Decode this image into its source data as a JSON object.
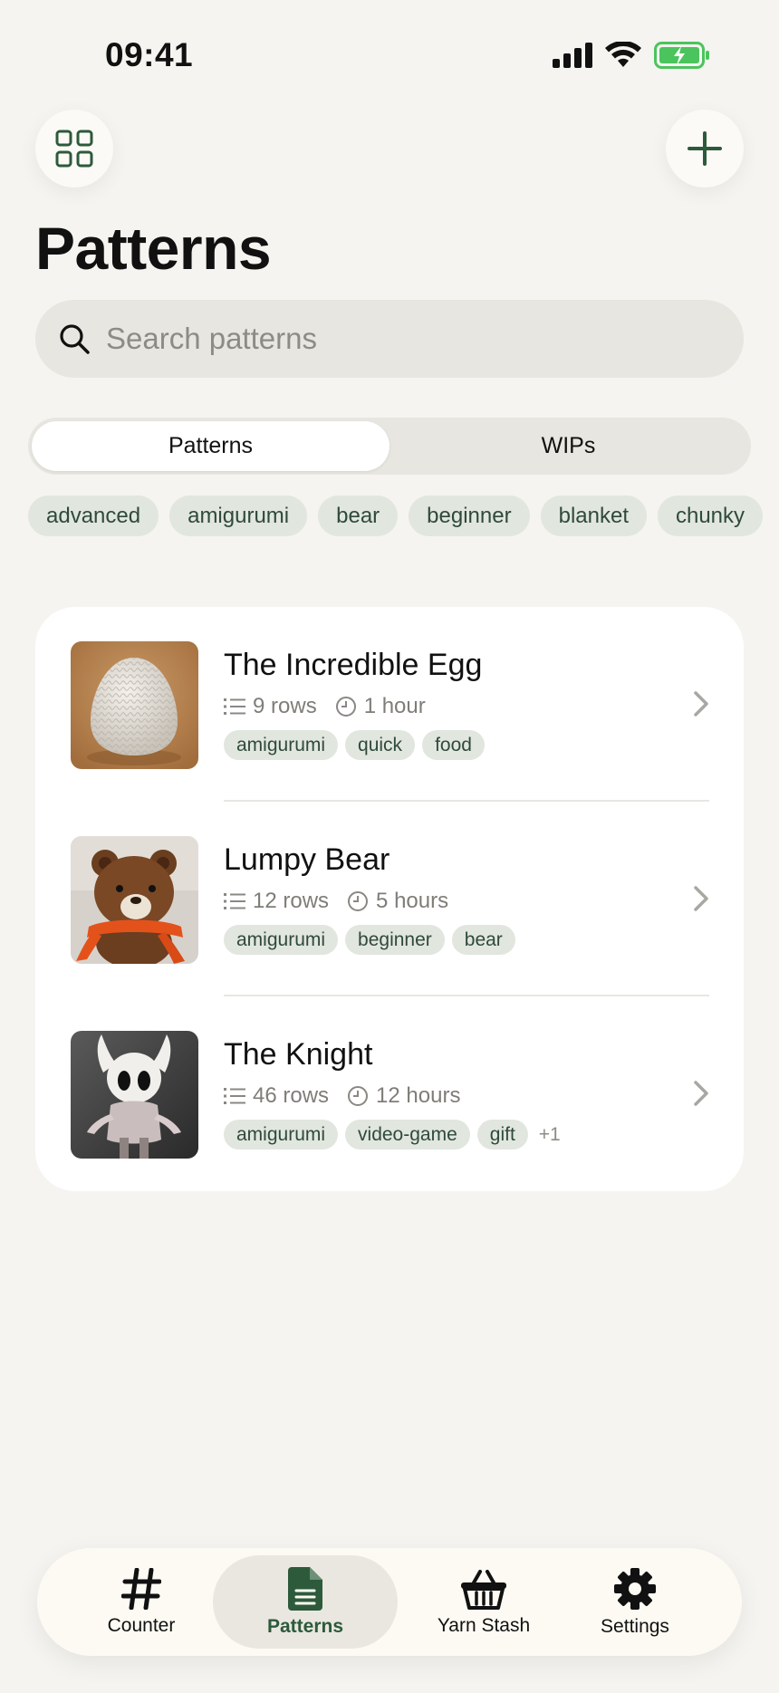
{
  "status_bar": {
    "time": "09:41"
  },
  "page": {
    "title": "Patterns"
  },
  "search": {
    "placeholder": "Search patterns"
  },
  "segments": {
    "patterns": "Patterns",
    "wips": "WIPs",
    "active": "Patterns"
  },
  "filter_tags": [
    "advanced",
    "amigurumi",
    "bear",
    "beginner",
    "blanket",
    "chunky"
  ],
  "patterns": [
    {
      "title": "The Incredible Egg",
      "rows": "9 rows",
      "time": "1 hour",
      "tags": [
        "amigurumi",
        "quick",
        "food"
      ],
      "more": ""
    },
    {
      "title": "Lumpy Bear",
      "rows": "12 rows",
      "time": "5 hours",
      "tags": [
        "amigurumi",
        "beginner",
        "bear"
      ],
      "more": ""
    },
    {
      "title": "The Knight",
      "rows": "46 rows",
      "time": "12 hours",
      "tags": [
        "amigurumi",
        "video-game",
        "gift"
      ],
      "more": "+1"
    }
  ],
  "tab_bar": {
    "counter": "Counter",
    "patterns": "Patterns",
    "yarn_stash": "Yarn Stash",
    "settings": "Settings",
    "active": "Patterns"
  },
  "colors": {
    "accent": "#2d5a3b",
    "tag_bg": "#e1e6de",
    "background": "#f5f4f0",
    "battery": "#4bc45d"
  },
  "icons": [
    "grid-icon",
    "plus-icon",
    "search-icon",
    "list-icon",
    "clock-icon",
    "chevron-right-icon",
    "hash-icon",
    "document-icon",
    "basket-icon",
    "gear-icon",
    "signal-icon",
    "wifi-icon",
    "battery-icon"
  ]
}
